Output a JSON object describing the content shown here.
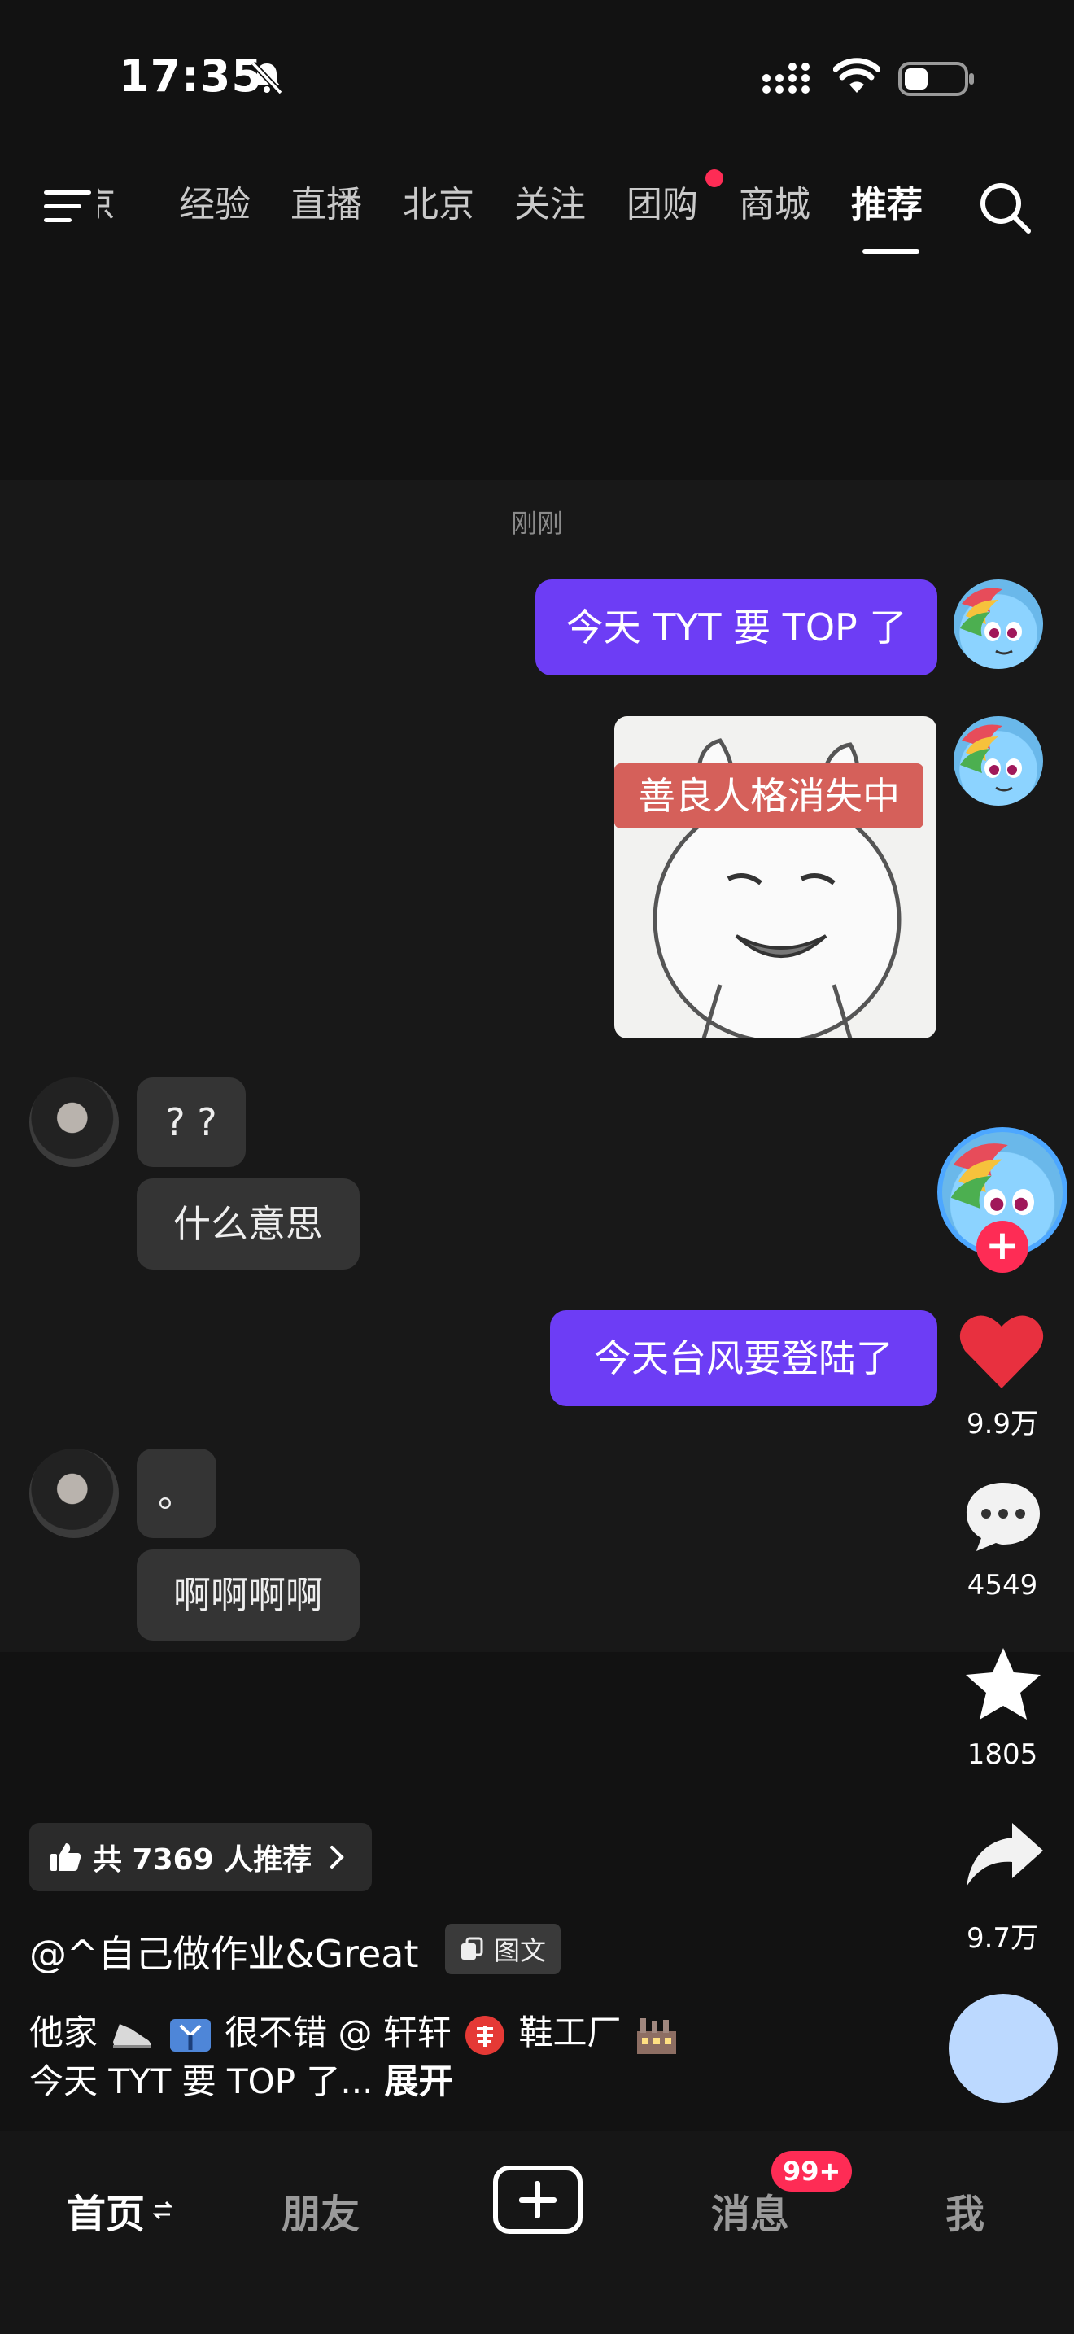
{
  "status_bar": {
    "time": "17:35"
  },
  "top_nav": {
    "tabs": [
      {
        "label": "京"
      },
      {
        "label": "经验"
      },
      {
        "label": "直播"
      },
      {
        "label": "北京"
      },
      {
        "label": "关注"
      },
      {
        "label": "团购"
      },
      {
        "label": "商城"
      },
      {
        "label": "推荐"
      }
    ],
    "active_tab": "推荐"
  },
  "chat": {
    "timestamp": "刚刚",
    "messages": [
      {
        "text": "今天 TYT 要 TOP 了"
      },
      {
        "meme_caption": "善良人格消失中"
      },
      {
        "text": "? ?"
      },
      {
        "text": "什么意思"
      },
      {
        "text": "今天台风要登陆了"
      },
      {
        "text": "。"
      },
      {
        "text": "啊啊啊啊"
      }
    ]
  },
  "actions": {
    "likes": "9.9万",
    "comments": "4549",
    "favorites": "1805",
    "shares": "9.7万"
  },
  "post": {
    "recommend_label": "共 7369 人推荐",
    "author": "@^自己做作业&Great",
    "type_badge": "图文",
    "desc_part1": "他家",
    "desc_part2": "很不错 @ 轩轩",
    "desc_part3": "鞋工厂",
    "desc_line2": "今天 TYT 要 TOP 了...",
    "expand": "展开"
  },
  "bottom_nav": {
    "home": "首页",
    "friends": "朋友",
    "messages": "消息",
    "messages_badge": "99+",
    "me": "我"
  },
  "colors": {
    "accent_purple": "#6d3df5",
    "badge_red": "#fe2c55",
    "background": "#121212"
  }
}
